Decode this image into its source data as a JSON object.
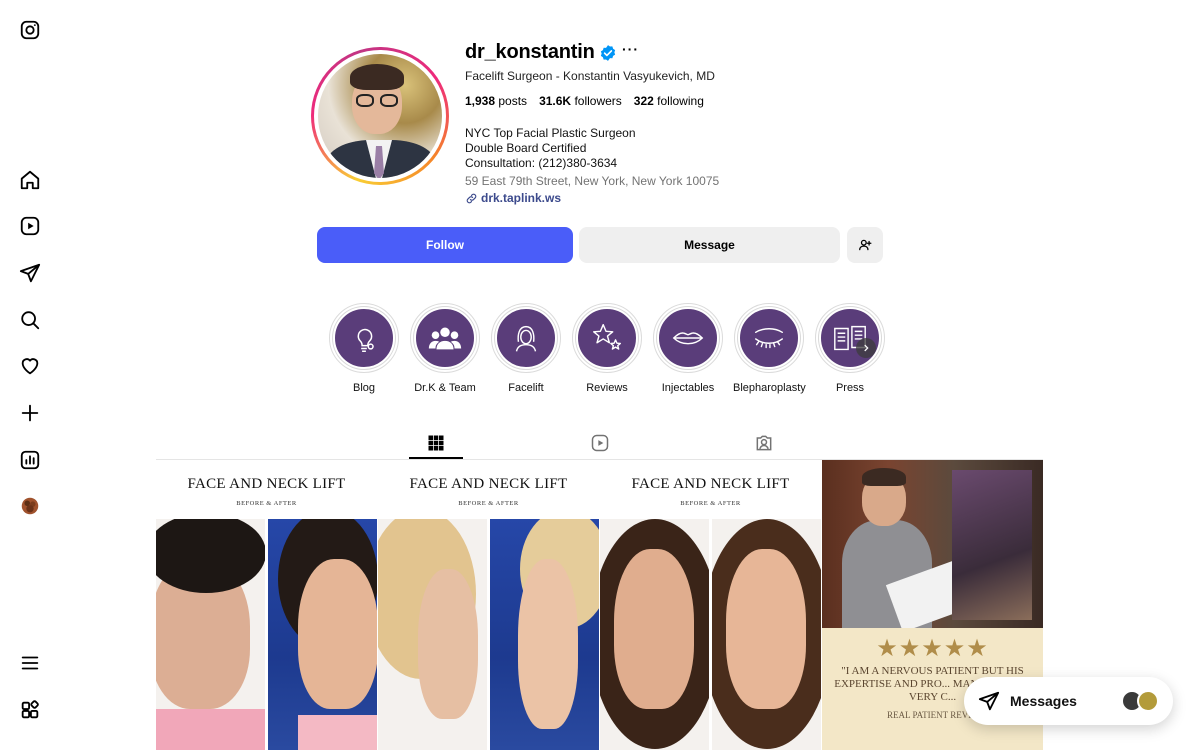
{
  "profile": {
    "username": "dr_konstantin",
    "full_name": "Facelift Surgeon - Konstantin Vasyukevich, MD",
    "posts_count": "1,938",
    "posts_label": "posts",
    "followers_count": "31.6K",
    "followers_label": "followers",
    "following_count": "322",
    "following_label": "following",
    "bio_line1": "NYC Top Facial Plastic Surgeon",
    "bio_line2": "Double Board Certified",
    "bio_line3": "Consultation: (212)380-3634",
    "address": "59 East 79th Street, New York, New York 10075",
    "link": "drk.taplink.ws",
    "more": "···"
  },
  "actions": {
    "follow": "Follow",
    "message": "Message"
  },
  "highlights": [
    {
      "label": "Blog",
      "icon": "lightbulb-icon"
    },
    {
      "label": "Dr.K & Team",
      "icon": "team-icon"
    },
    {
      "label": "Facelift",
      "icon": "woman-face-icon"
    },
    {
      "label": "Reviews",
      "icon": "stars-icon"
    },
    {
      "label": "Injectables",
      "icon": "lips-icon"
    },
    {
      "label": "Blepharoplasty",
      "icon": "eye-icon"
    },
    {
      "label": "Press",
      "icon": "book-icon"
    }
  ],
  "tabs": [
    {
      "name": "posts",
      "icon": "grid-icon",
      "active": true
    },
    {
      "name": "reels",
      "icon": "reels-icon",
      "active": false
    },
    {
      "name": "tagged",
      "icon": "tagged-icon",
      "active": false
    }
  ],
  "posts": [
    {
      "title": "FACE AND NECK LIFT",
      "subtitle": "BEFORE & AFTER"
    },
    {
      "title": "FACE AND NECK LIFT",
      "subtitle": "BEFORE & AFTER"
    },
    {
      "title": "FACE AND NECK LIFT",
      "subtitle": "BEFORE & AFTER"
    },
    {
      "stars": "★★★★★",
      "quote": "\"I AM A NERVOUS PATIENT BUT HIS EXPERTISE AND PRO... MANNERS ARE VERY C...",
      "quote_sub": "REAL PATIENT REVI..."
    }
  ],
  "messages": {
    "label": "Messages"
  },
  "colors": {
    "follow_button": "#4a5df9",
    "secondary_button": "#efefef",
    "highlight_bg": "#5a3d7a",
    "verified": "#0095f6",
    "link": "#3c4a8c"
  }
}
